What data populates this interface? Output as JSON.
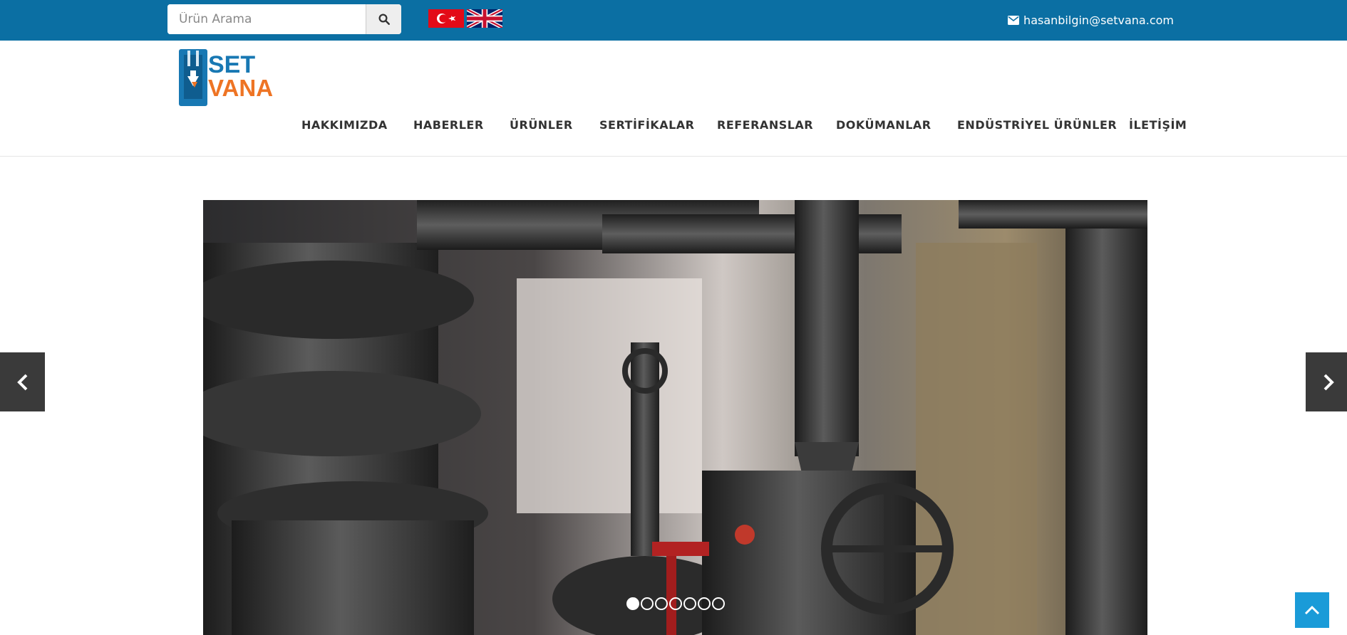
{
  "topbar": {
    "search_placeholder": "Ürün Arama",
    "search_button_icon": "search-icon",
    "flags": [
      "turkish-flag",
      "uk-flag"
    ],
    "email": "hasanbilgin@setvana.com",
    "background_color": "#0b6fa3"
  },
  "header": {
    "logo": {
      "line1": "SET",
      "line2": "VANA",
      "blue": "#1878b3",
      "orange": "#ee7424"
    },
    "nav": [
      {
        "label": "HAKKIMIZDA"
      },
      {
        "label": "HABERLER"
      },
      {
        "label": "ÜRÜNLER"
      },
      {
        "label": "SERTİFİKALAR"
      },
      {
        "label": "REFERANSLAR"
      },
      {
        "label": "DOKÜMANLAR"
      },
      {
        "label": "ENDÜSTRİYEL ÜRÜNLER"
      },
      {
        "label": "İLETİŞİM"
      }
    ]
  },
  "slider": {
    "image": "industrial-valves-and-pipes-photo",
    "slide_count": 7,
    "active_index": 0,
    "prev_icon": "chevron-left-icon",
    "next_icon": "chevron-right-icon"
  },
  "back_to_top": {
    "icon": "chevron-up-icon",
    "color": "#1a9bd8"
  }
}
